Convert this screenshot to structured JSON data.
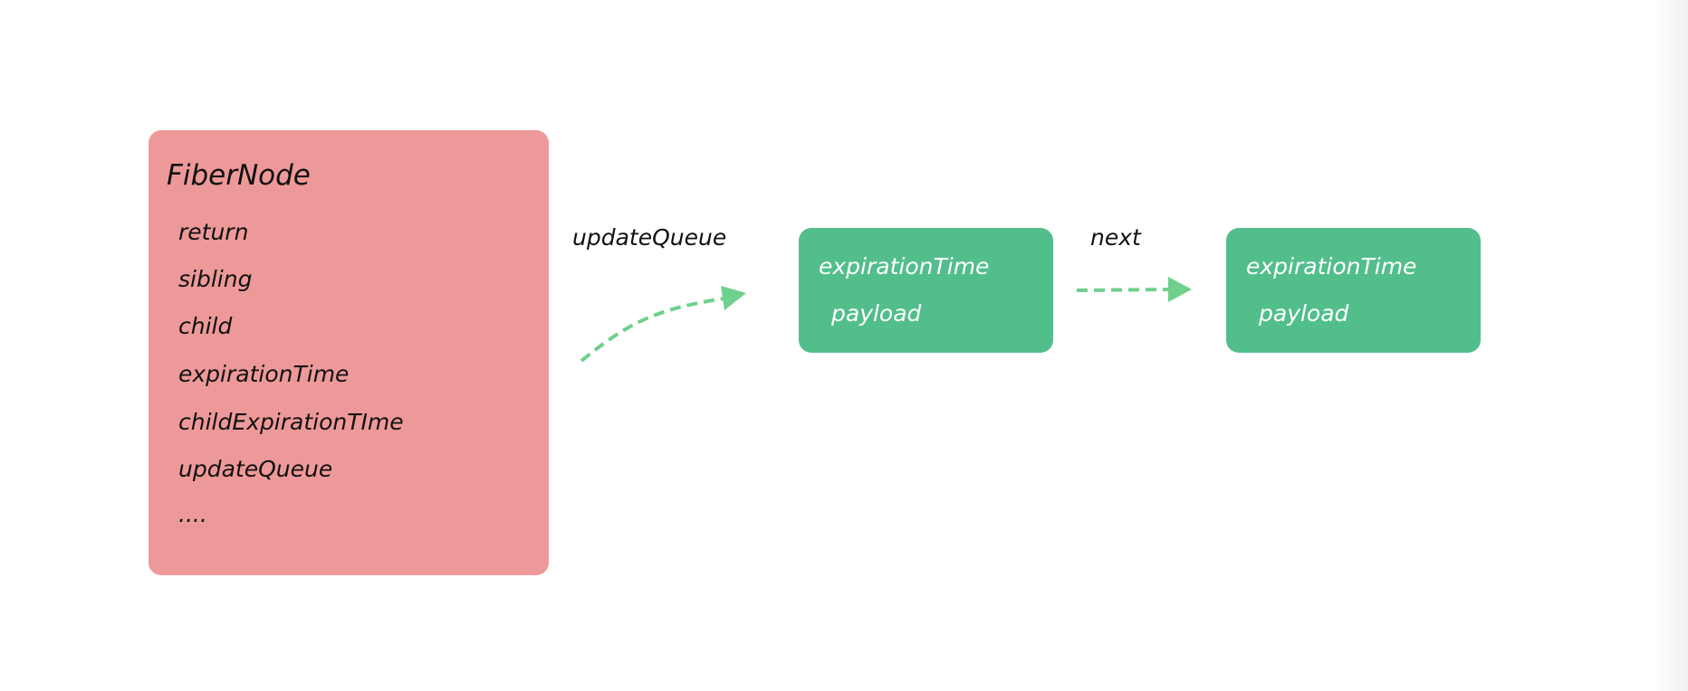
{
  "colors": {
    "fiber": "#EE9999",
    "node": "#52BE8C",
    "arrow": "#6FD08C"
  },
  "fiber_node": {
    "title": "FiberNode",
    "fields": [
      "return",
      "sibling",
      "child",
      "expirationTime",
      "childExpirationTIme",
      "updateQueue",
      "...."
    ]
  },
  "labels": {
    "update_queue": "updateQueue",
    "next": "next"
  },
  "update_nodes": [
    {
      "field1": "expirationTime",
      "field2": "payload"
    },
    {
      "field1": "expirationTime",
      "field2": "payload"
    }
  ]
}
